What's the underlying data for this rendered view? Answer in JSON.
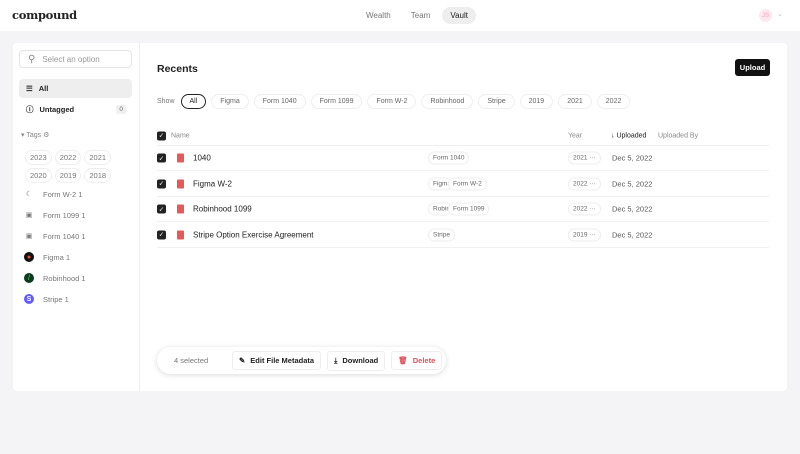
{
  "header": {
    "logo": "compound",
    "nav": [
      "Wealth",
      "Team",
      "Vault"
    ],
    "active_nav": "Vault",
    "avatar_initials": "JS"
  },
  "sidebar": {
    "search_placeholder": "Select an option",
    "all_label": "All",
    "untagged_label": "Untagged",
    "untagged_count": "0",
    "tags_label": "Tags",
    "years": [
      "2023",
      "2022",
      "2021",
      "2020",
      "2019",
      "2018"
    ],
    "tags": [
      {
        "label": "Form W-2 1",
        "icon": "moon-icon"
      },
      {
        "label": "Form 1099 1",
        "icon": "form-icon"
      },
      {
        "label": "Form 1040 1",
        "icon": "form-icon"
      },
      {
        "label": "Figma 1",
        "icon": "figma-logo-icon"
      },
      {
        "label": "Robinhood 1",
        "icon": "robinhood-logo-icon"
      },
      {
        "label": "Stripe 1",
        "icon": "stripe-logo-icon"
      }
    ]
  },
  "main": {
    "title": "Recents",
    "upload_label": "Upload",
    "show_label": "Show",
    "filters": [
      "All",
      "Figma",
      "Form 1040",
      "Form 1099",
      "Form W-2",
      "Robinhood",
      "Stripe",
      "2019",
      "2021",
      "2022"
    ],
    "active_filter": "All",
    "columns": {
      "name": "Name",
      "year": "Year",
      "uploaded": "Uploaded",
      "uploaded_by": "Uploaded By"
    },
    "rows": [
      {
        "name": "1040",
        "tags": [
          "Form 1040"
        ],
        "year": "2021",
        "uploaded": "Dec 5, 2022"
      },
      {
        "name": "Figma W-2",
        "tags": [
          "Figma",
          "Form W-2"
        ],
        "year": "2022",
        "uploaded": "Dec 5, 2022"
      },
      {
        "name": "Robinhood 1099",
        "tags": [
          "Robinhood",
          "Form 1099"
        ],
        "year": "2022",
        "uploaded": "Dec 5, 2022"
      },
      {
        "name": "Stripe Option Exercise Agreement",
        "tags": [
          "Stripe"
        ],
        "year": "2019",
        "uploaded": "Dec 5, 2022"
      }
    ]
  },
  "action_bar": {
    "selected": "4 selected",
    "edit": "Edit File Metadata",
    "download": "Download",
    "delete": "Delete"
  },
  "colors": {
    "accent": "#111111",
    "danger": "#e0505a",
    "pdf": "#e25b5b"
  }
}
